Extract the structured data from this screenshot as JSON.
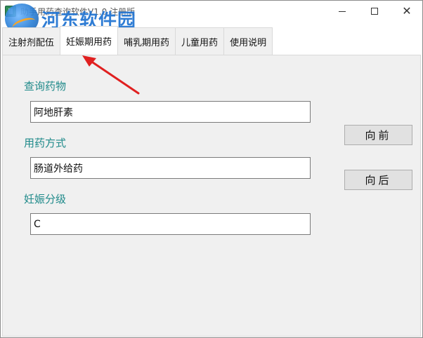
{
  "window": {
    "title": "助手用药查询软件V1.0 注册版",
    "controls": [
      "minimize",
      "maximize",
      "close"
    ]
  },
  "watermark": {
    "text": "河东软件园",
    "url": "www.pc0359.cn"
  },
  "tabs": [
    {
      "label": "注射剂配伍",
      "active": false
    },
    {
      "label": "妊娠期用药",
      "active": true
    },
    {
      "label": "哺乳期用药",
      "active": false
    },
    {
      "label": "儿童用药",
      "active": false
    },
    {
      "label": "使用说明",
      "active": false
    }
  ],
  "form": {
    "query_label": "查询药物",
    "query_value": "阿地肝素",
    "route_label": "用药方式",
    "route_value": "肠道外给药",
    "grade_label": "妊娠分级",
    "grade_value": "C"
  },
  "buttons": {
    "prev": "向前",
    "next": "向后"
  },
  "colors": {
    "label_teal": "#1f8a8a",
    "arrow_red": "#e02020",
    "panel_bg": "#f0f0f0"
  }
}
